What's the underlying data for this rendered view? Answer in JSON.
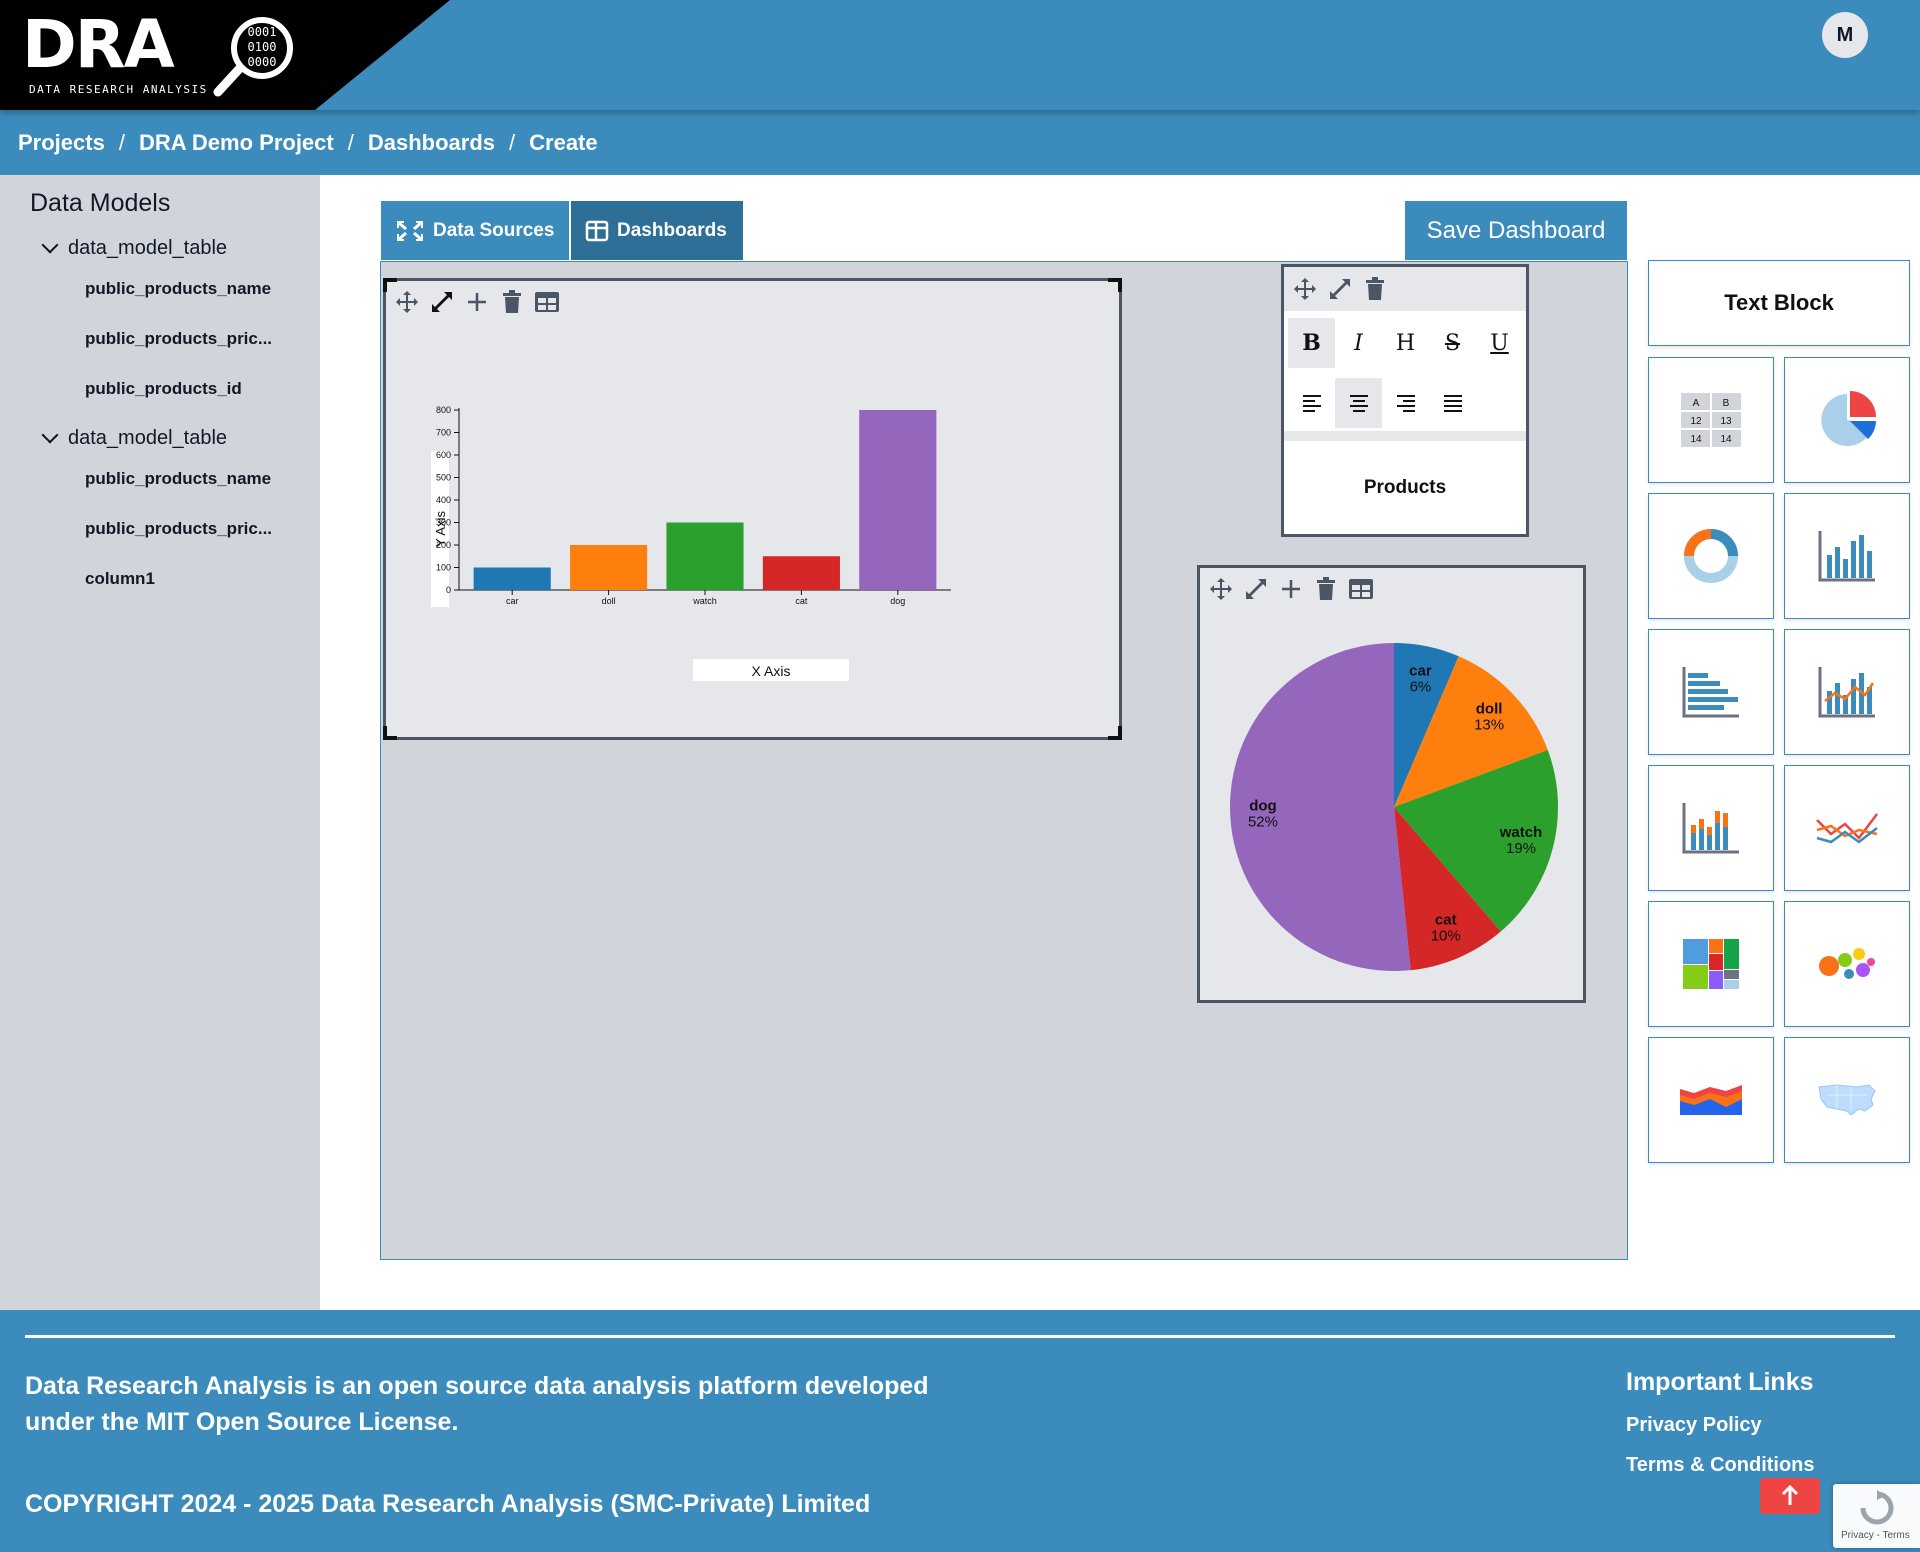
{
  "brand": {
    "logo_text": "DRA",
    "logo_subtitle": "DATA RESEARCH ANALYSIS",
    "logo_binary": [
      "0001",
      "0100",
      "0000"
    ]
  },
  "user": {
    "initial": "M"
  },
  "breadcrumb": [
    "Projects",
    "DRA Demo Project",
    "Dashboards",
    "Create"
  ],
  "breadcrumb_sep": "/",
  "sidebar": {
    "title": "Data Models",
    "groups": [
      {
        "name": "data_model_table",
        "items": [
          "public_products_name",
          "public_products_pric...",
          "public_products_id"
        ]
      },
      {
        "name": "data_model_table",
        "items": [
          "public_products_name",
          "public_products_pric...",
          "column1"
        ]
      }
    ]
  },
  "tabs": {
    "data_sources": "Data Sources",
    "dashboards": "Dashboards"
  },
  "save_button": "Save Dashboard",
  "text_widget": {
    "content": "Products",
    "format_buttons": [
      "B",
      "I",
      "H",
      "S",
      "U"
    ]
  },
  "palette": {
    "text_block": "Text Block",
    "table_icon_cells": [
      "A",
      "B",
      "12",
      "13",
      "14",
      "14"
    ],
    "widgets": [
      "table-icon",
      "pie-chart-icon",
      "donut-chart-icon",
      "vertical-bar-chart-icon",
      "horizontal-bar-chart-icon",
      "bar-line-combo-icon",
      "stacked-bar-chart-icon",
      "multi-line-chart-icon",
      "treemap-icon",
      "bubble-chart-icon",
      "stacked-area-chart-icon",
      "usa-map-icon"
    ]
  },
  "charts": [
    {
      "chart_data": {
        "type": "bar",
        "categories": [
          "car",
          "doll",
          "watch",
          "cat",
          "dog"
        ],
        "values": [
          100,
          200,
          300,
          150,
          800
        ],
        "colors": [
          "#1f77b4",
          "#ff7f0e",
          "#2ca02c",
          "#d62728",
          "#9467bd"
        ],
        "xlabel": "X Axis",
        "ylabel": "Y Axis",
        "ylim": [
          0,
          800
        ],
        "yticks": [
          0,
          100,
          200,
          300,
          400,
          500,
          600,
          700,
          800
        ]
      }
    },
    {
      "chart_data": {
        "type": "pie",
        "categories": [
          "car",
          "doll",
          "watch",
          "cat",
          "dog"
        ],
        "values": [
          100,
          200,
          300,
          150,
          800
        ],
        "percent_labels": [
          "6%",
          "13%",
          "19%",
          "10%",
          "52%"
        ],
        "colors": [
          "#1f77b4",
          "#ff7f0e",
          "#2ca02c",
          "#d62728",
          "#9467bd"
        ]
      }
    }
  ],
  "footer": {
    "about": "Data Research Analysis is an open source data analysis platform developed under the MIT Open Source License.",
    "copyright": "COPYRIGHT 2024 - 2025 Data Research Analysis (SMC-Private) Limited",
    "links_title": "Important Links",
    "links": [
      "Privacy Policy",
      "Terms & Conditions"
    ],
    "recaptcha_text": "Privacy - Terms"
  }
}
